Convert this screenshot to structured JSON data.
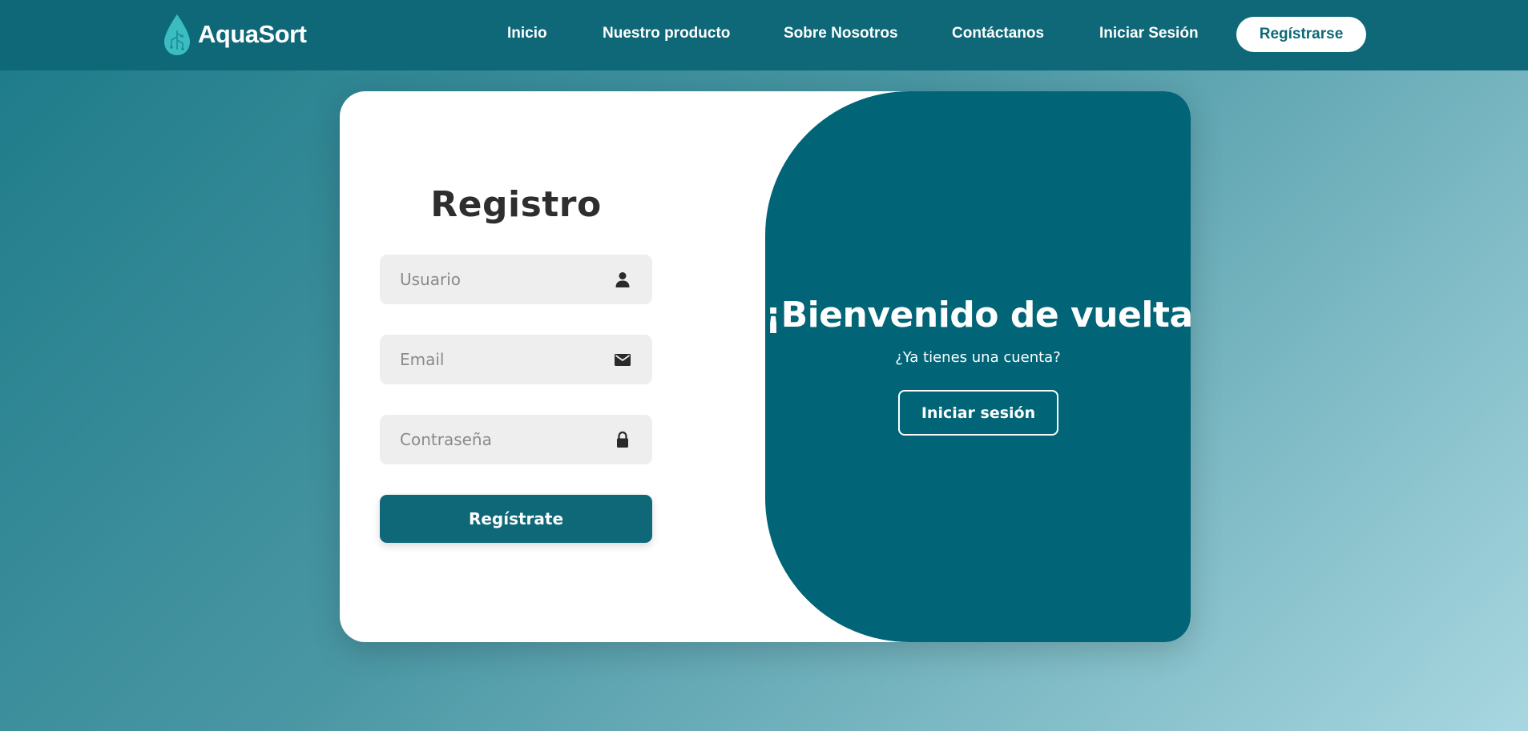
{
  "navbar": {
    "brand": "AquaSort",
    "links": [
      {
        "label": "Inicio"
      },
      {
        "label": "Nuestro producto"
      },
      {
        "label": "Sobre Nosotros"
      },
      {
        "label": "Contáctanos"
      },
      {
        "label": "Iniciar Sesión"
      }
    ],
    "register_label": "Regístrarse"
  },
  "form": {
    "title": "Registro",
    "fields": [
      {
        "placeholder": "Usuario",
        "icon": "user-icon"
      },
      {
        "placeholder": "Email",
        "icon": "envelope-icon"
      },
      {
        "placeholder": "Contraseña",
        "icon": "lock-icon"
      }
    ],
    "submit_label": "Regístrate"
  },
  "welcome": {
    "title": "¡Bienvenido de vuelta!",
    "subtitle": "¿Ya tienes una cuenta?",
    "login_label": "Iniciar sesión"
  },
  "colors": {
    "primary": "#016577",
    "navbar": "#0e6878",
    "field_bg": "#eeeeee",
    "brand_drop": "#3bbcc0"
  }
}
